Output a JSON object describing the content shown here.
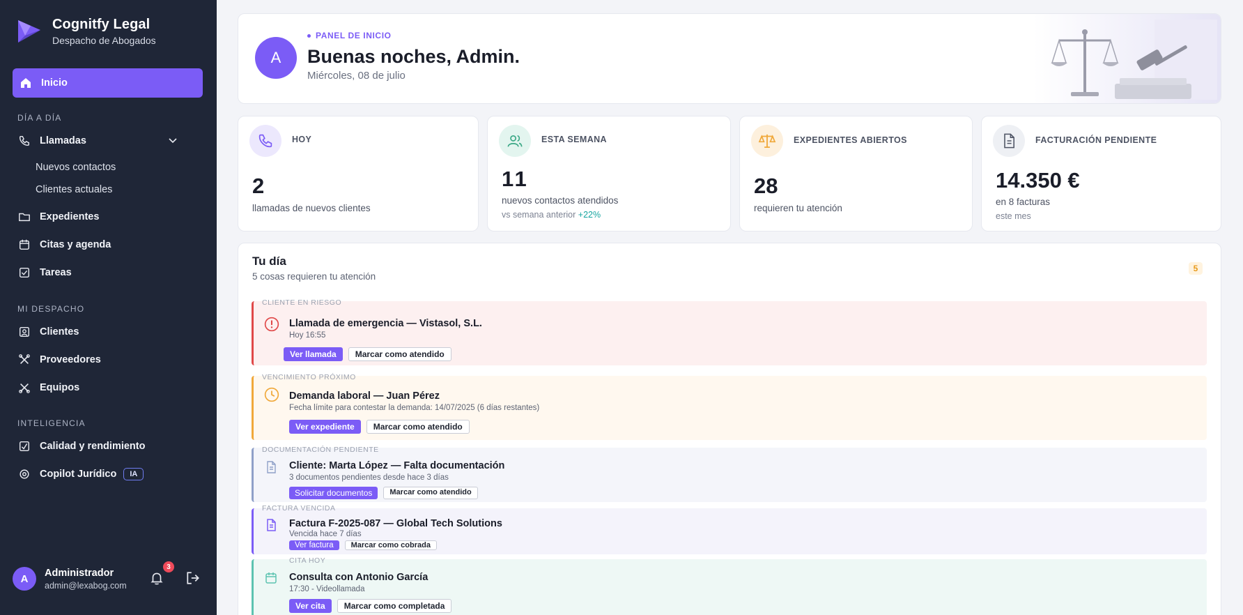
{
  "brand": {
    "name": "Cognitfy Legal",
    "subtitle": "Despacho de Abogados"
  },
  "sidebar": {
    "home": "Inicio",
    "section_day": "DÍA A DÍA",
    "calls": "Llamadas",
    "calls_sub": [
      "Nuevos contactos",
      "Clientes actuales"
    ],
    "files": "Expedientes",
    "appointments": "Citas y agenda",
    "tasks": "Tareas",
    "section_firm": "MI DESPACHO",
    "clients": "Clientes",
    "providers": "Proveedores",
    "teams": "Equipos",
    "section_intel": "INTELIGENCIA",
    "quality": "Calidad y rendimiento",
    "copilot": "Copilot Jurídico",
    "copilot_badge": "IA"
  },
  "user": {
    "initial": "A",
    "name": "Administrador",
    "email": "admin@lexabog.com",
    "notifications": "3"
  },
  "hero": {
    "initial": "A",
    "eyebrow": "PANEL DE INICIO",
    "title": "Buenas noches, Admin.",
    "date": "Miércoles, 08 de julio"
  },
  "stats": [
    {
      "label": "HOY",
      "value": "2",
      "desc": "llamadas de nuevos clientes"
    },
    {
      "label": "ESTA SEMANA",
      "value": "11",
      "desc": "nuevos contactos atendidos",
      "sub": "vs semana anterior",
      "delta": "+22%"
    },
    {
      "label": "EXPEDIENTES ABIERTOS",
      "value": "28",
      "desc": "requieren tu atención"
    },
    {
      "label": "FACTURACIÓN PENDIENTE",
      "value": "14.350 €",
      "desc": "en 8 facturas",
      "sub": "este mes"
    }
  ],
  "day": {
    "title": "Tu día",
    "subtitle": "5 cosas requieren tu atención",
    "count": "5",
    "items": [
      {
        "tag": "CLIENTE EN RIESGO",
        "title": "Llamada de emergencia — Vistasol, S.L.",
        "meta": "Hoy 16:55",
        "primary": "Ver llamada",
        "secondary": "Marcar como atendido"
      },
      {
        "tag": "VENCIMIENTO PRÓXIMO",
        "title": "Demanda laboral — Juan Pérez",
        "meta": "Fecha límite para contestar la demanda: 14/07/2025 (6 días restantes)",
        "primary": "Ver expediente",
        "secondary": "Marcar como atendido"
      },
      {
        "tag": "DOCUMENTACIÓN PENDIENTE",
        "title": "Cliente: Marta López — Falta documentación",
        "meta": "3 documentos pendientes desde hace 3 días",
        "primary": "Solicitar documentos",
        "secondary": "Marcar como atendido"
      },
      {
        "tag": "FACTURA VENCIDA",
        "title": "Factura F-2025-087 — Global Tech Solutions",
        "meta": "Vencida hace 7 días",
        "primary": "Ver factura",
        "secondary": "Marcar como cobrada"
      },
      {
        "tag": "CITA HOY",
        "title": "Consulta con Antonio García",
        "meta": "17:30 - Videollamada",
        "primary": "Ver cita",
        "secondary": "Marcar como completada"
      }
    ]
  },
  "colors": {
    "accent": "#7b5cf6",
    "sidebar": "#1f2637",
    "danger": "#e04848",
    "warning": "#f0a83a",
    "docs": "#8fa0c8",
    "invoice": "#7b5cf6",
    "appointment": "#5cc3b0"
  }
}
